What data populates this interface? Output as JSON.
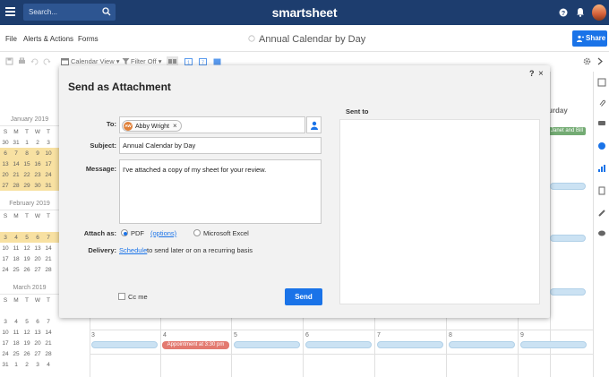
{
  "topbar": {
    "search_placeholder": "Search...",
    "brand": "smartsheet"
  },
  "menubar": {
    "file": "File",
    "alerts": "Alerts & Actions",
    "forms": "Forms",
    "sheet_title": "Annual Calendar by Day",
    "share": "Share"
  },
  "toolbar": {
    "calendar_view": "Calendar View ▾",
    "filter": "Filter Off ▾"
  },
  "calendar": {
    "saturday_header": "urday",
    "event_green": "Janet and Bill",
    "appointment": "Appointment at 3:30 pm",
    "day_numbers": [
      "3",
      "4",
      "5",
      "6",
      "7",
      "8",
      "9"
    ],
    "months": [
      {
        "title": "January 2019",
        "weekdays": [
          "S",
          "M",
          "T",
          "W",
          "T"
        ],
        "rows": [
          [
            "30",
            "31",
            "1",
            "2",
            "3"
          ],
          [
            "6",
            "7",
            "8",
            "9",
            "10"
          ],
          [
            "13",
            "14",
            "15",
            "16",
            "17"
          ],
          [
            "20",
            "21",
            "22",
            "23",
            "24"
          ],
          [
            "27",
            "28",
            "29",
            "30",
            "31"
          ]
        ],
        "highlighted_rows": [
          1,
          2,
          3,
          4
        ]
      },
      {
        "title": "February 2019",
        "weekdays": [
          "S",
          "M",
          "T",
          "W",
          "T"
        ],
        "rows": [
          [
            "",
            "",
            "",
            "",
            ""
          ],
          [
            "3",
            "4",
            "5",
            "6",
            "7"
          ],
          [
            "10",
            "11",
            "12",
            "13",
            "14"
          ],
          [
            "17",
            "18",
            "19",
            "20",
            "21"
          ],
          [
            "24",
            "25",
            "26",
            "27",
            "28"
          ]
        ],
        "highlighted_rows": [
          1
        ]
      },
      {
        "title": "March 2019",
        "weekdays": [
          "S",
          "M",
          "T",
          "W",
          "T"
        ],
        "rows": [
          [
            "",
            "",
            "",
            "",
            ""
          ],
          [
            "3",
            "4",
            "5",
            "6",
            "7"
          ],
          [
            "10",
            "11",
            "12",
            "13",
            "14"
          ],
          [
            "17",
            "18",
            "19",
            "20",
            "21"
          ],
          [
            "24",
            "25",
            "26",
            "27",
            "28"
          ],
          [
            "31",
            "1",
            "2",
            "3",
            "4"
          ]
        ],
        "highlighted_rows": []
      }
    ]
  },
  "dialog": {
    "title": "Send as Attachment",
    "help": "?",
    "close": "×",
    "to_label": "To:",
    "recipient": {
      "initials": "AW",
      "name": "Abby Wright",
      "remove": "×"
    },
    "subject_label": "Subject:",
    "subject_value": "Annual Calendar by Day",
    "message_label": "Message:",
    "message_value": "I've attached a copy of my sheet for your review.",
    "attach_label": "Attach as:",
    "attach_options": [
      {
        "label": "PDF",
        "selected": true
      },
      {
        "label": "Microsoft Excel",
        "selected": false
      }
    ],
    "options_link": "(options)",
    "delivery_label": "Delivery:",
    "schedule_link": "Schedule",
    "delivery_text": "to send later or on a recurring basis",
    "cc_label": "Cc me",
    "cc_checked": false,
    "send_label": "Send",
    "sent_to_label": "Sent to"
  },
  "colors": {
    "topbar": "#1d3d6e",
    "accent": "#1a73e8",
    "calendar_highlight": "#f6d67e",
    "event_bar": "#b8d7ef",
    "appointment": "#d8473a",
    "green_event": "#3d8b3d"
  },
  "icons": {
    "menu": "hamburger-icon",
    "search": "search-icon",
    "help": "help-icon",
    "notifications": "bell-icon",
    "contacts": "person-icon"
  }
}
